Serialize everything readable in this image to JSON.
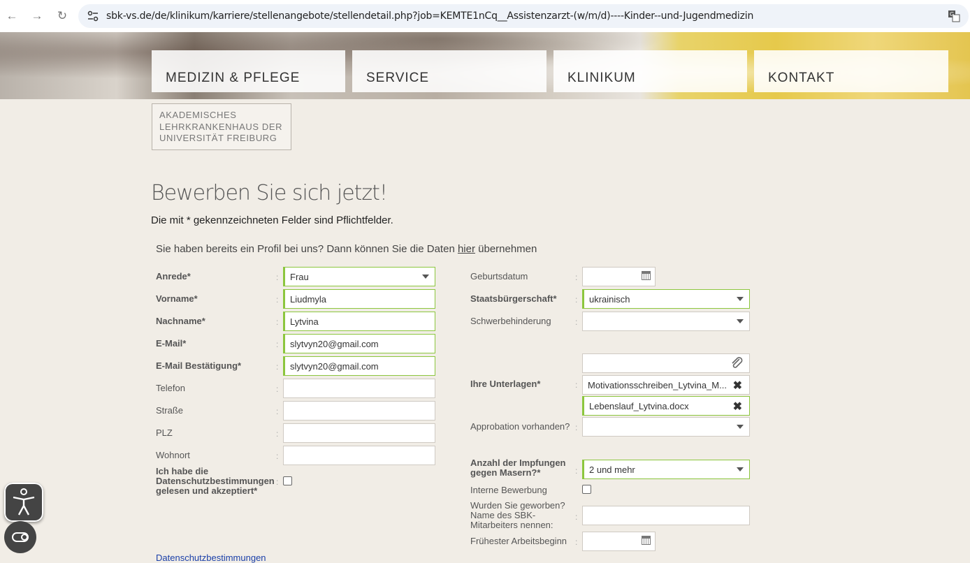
{
  "browser": {
    "url": "sbk-vs.de/de/klinikum/karriere/stellenangebote/stellendetail.php?job=KEMTE1nCq__Assistenzarzt-(w/m/d)----Kinder--und-Jugendmedizin"
  },
  "nav": {
    "items": [
      "MEDIZIN & PFLEGE",
      "SERVICE",
      "KLINIKUM",
      "KONTAKT"
    ]
  },
  "logo": {
    "lines": [
      "AKADEMISCHES",
      "LEHRKRANKENHAUS DER",
      "UNIVERSITÄT FREIBURG"
    ]
  },
  "page": {
    "title": "Bewerben Sie sich jetzt!",
    "required_note": "Die mit * gekennzeichneten Felder sind Pflichtfelder.",
    "profile_note_pre": "Sie haben bereits ein Profil bei uns? Dann können Sie die Daten ",
    "profile_note_link": "hier",
    "profile_note_post": " übernehmen"
  },
  "form_left": {
    "anrede": {
      "label": "Anrede",
      "value": "Frau"
    },
    "vorname": {
      "label": "Vorname",
      "value": "Liudmyla"
    },
    "nachname": {
      "label": "Nachname",
      "value": "Lytvina"
    },
    "email": {
      "label": "E-Mail",
      "value": "slytvyn20@gmail.com"
    },
    "email_confirm": {
      "label": "E-Mail Bestätigung",
      "value": "slytvyn20@gmail.com"
    },
    "telefon": {
      "label": "Telefon",
      "value": ""
    },
    "strasse": {
      "label": "Straße",
      "value": ""
    },
    "plz": {
      "label": "PLZ",
      "value": ""
    },
    "wohnort": {
      "label": "Wohnort",
      "value": ""
    },
    "privacy": {
      "label_1": "Ich habe die",
      "label_2": "Datenschutzbestimmungen",
      "label_3": "gelesen und akzeptiert",
      "checked": false
    }
  },
  "form_right": {
    "geburtsdatum": {
      "label": "Geburtsdatum",
      "value": ""
    },
    "staatsbuergerschaft": {
      "label": "Staatsbürgerschaft",
      "value": "ukrainisch"
    },
    "schwerbehinderung": {
      "label": "Schwerbehinderung",
      "value": ""
    },
    "unterlagen": {
      "label": "Ihre Unterlagen",
      "files": [
        "Motivationsschreiben_Lytvina_M...",
        "Lebenslauf_Lytvina.docx"
      ]
    },
    "approbation": {
      "label": "Approbation vorhanden?",
      "value": ""
    },
    "impfungen": {
      "label_1": "Anzahl der Impfungen",
      "label_2": "gegen Masern?",
      "value": "2 und mehr"
    },
    "interne": {
      "label": "Interne Bewerbung",
      "checked": false
    },
    "geworben": {
      "label_1": "Wurden Sie geworben?",
      "label_2": "Name des SBK-",
      "label_3": "Mitarbeiters nennen:",
      "value": ""
    },
    "arbeitsbeginn": {
      "label": "Frühester Arbeitsbeginn",
      "value": ""
    }
  },
  "required_mark": "*",
  "colon": ":",
  "footer_link": "Datenschutzbestimmungen",
  "icons": {
    "remove": "✖",
    "attach": "paperclip-icon"
  }
}
